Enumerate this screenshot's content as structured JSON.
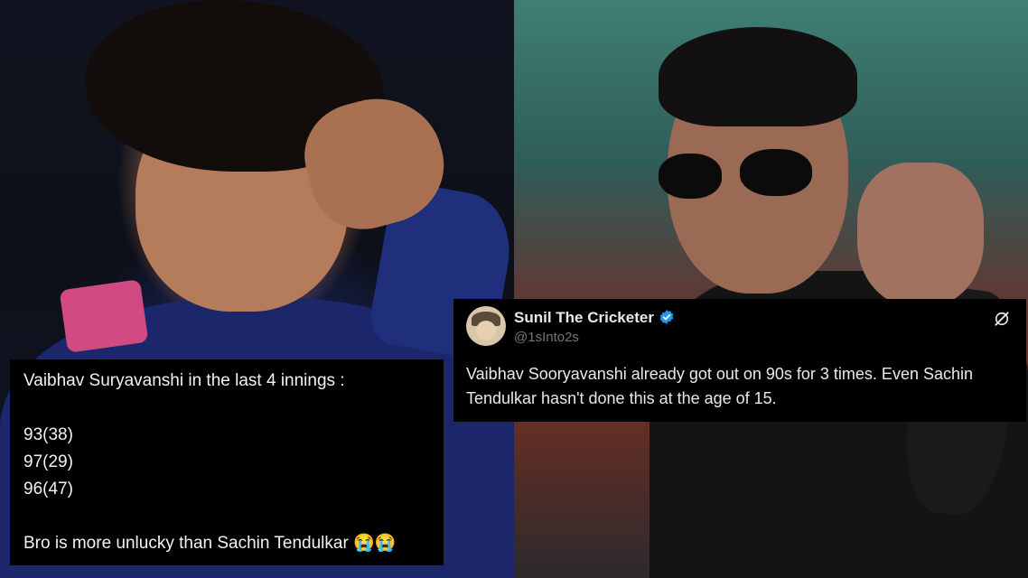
{
  "left_caption": {
    "heading": "Vaibhav Suryavanshi in the last 4 innings :",
    "scores": [
      "93(38)",
      "97(29)",
      "96(47)"
    ],
    "closing": "Bro is more unlucky than Sachin Tendulkar 😭😭"
  },
  "tweet": {
    "display_name": "Sunil The Cricketer",
    "handle": "@1sInto2s",
    "text": "Vaibhav Sooryavanshi already got out on 90s for 3 times. Even Sachin Tendulkar hasn't done this at the age of 15.",
    "verified_color": "#1d9bf0",
    "icons": [
      "verified-badge-icon",
      "grok-slash-icon"
    ]
  }
}
